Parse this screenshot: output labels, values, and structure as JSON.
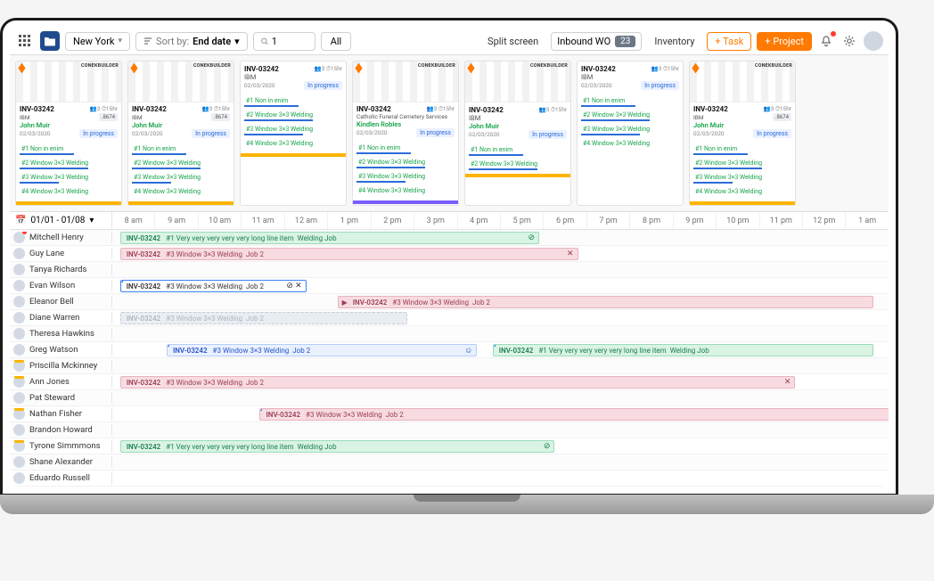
{
  "toolbar": {
    "location": "New York",
    "sort_label": "Sort by:",
    "sort_value": "End date",
    "search_value": "1",
    "tab_all": "All",
    "split_screen": "Split screen",
    "inbound_label": "Inbound WO",
    "inbound_count": "23",
    "inventory": "Inventory",
    "task_btn": "+ Task",
    "project_btn": "+ Project"
  },
  "card_common": {
    "inv": "INV-03242",
    "ibm": "IBM",
    "john": "John Muir",
    "date": "02/03/2020",
    "status": "In progress",
    "meta_people": "3",
    "meta_time": "15hr",
    "badge": ".8674",
    "catholic": "Catholic Funeral Cemetery Services",
    "kindlen": "Kindlen Robles",
    "l1": "#1 Non in enim",
    "l2": "#2 Window 3×3 Welding",
    "l3": "#3 Window 3×3 Welding",
    "l4": "#4 Window 3×3 Welding"
  },
  "timeline": {
    "date_range": "01/01 - 01/08",
    "hours": [
      "8 am",
      "9 am",
      "10 am",
      "11 am",
      "12 am",
      "1 pm",
      "2 pm",
      "3 pm",
      "4 pm",
      "5 pm",
      "6 pm",
      "7 pm",
      "8 pm",
      "9 pm",
      "10 pm",
      "11 pm",
      "12 pm",
      "1 am"
    ],
    "people": [
      {
        "name": "Mitchell Henry",
        "dot": true
      },
      {
        "name": "Guy Lane"
      },
      {
        "name": "Tanya Richards"
      },
      {
        "name": "Evan Wilson"
      },
      {
        "name": "Eleanor Bell"
      },
      {
        "name": "Diane Warren"
      },
      {
        "name": "Theresa Hawkins"
      },
      {
        "name": "Greg Watson"
      },
      {
        "name": "Priscilla Mckinney",
        "hat": true
      },
      {
        "name": "Ann Jones",
        "hat": true
      },
      {
        "name": "Pat Steward"
      },
      {
        "name": "Nathan Fisher",
        "hat": true
      },
      {
        "name": "Brandon Howard"
      },
      {
        "name": "Tyrone Simmmons",
        "hat": true
      },
      {
        "name": "Shane Alexander"
      },
      {
        "name": "Eduardo Russell"
      }
    ],
    "labels": {
      "inv": "INV-03242",
      "long_line": "#1 Very very very very very long line item",
      "welding_job": "Welding Job",
      "win3": "#3 Window 3×3 Welding",
      "job2": "Job 2"
    }
  }
}
